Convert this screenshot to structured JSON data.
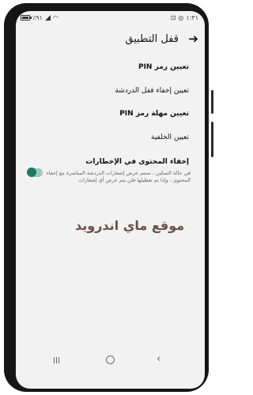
{
  "status_bar": {
    "battery_percent": "٪٩١",
    "time": "١:٣١",
    "icons": [
      "battery-icon",
      "signal-icon",
      "wifi-icon",
      "whatsapp-icon",
      "message-icon"
    ]
  },
  "header": {
    "title": "قفل التطبيق",
    "back_icon": "arrow-right-icon"
  },
  "settings": {
    "item1": "تعيين رمز PIN",
    "item2": "تعيين إخفاء قفل الدردشة",
    "item3": "تعيين مهلة رمز PIN",
    "item4": "تعيين الخلفية",
    "item5": "إخفاء المحتوى في الإخطارات",
    "item5_description": "في حالة التمكين ، ستتم عرض إشعارات الدردشة المباشرة مع إخفاء المحتوى ، وإذا تم تعطيلها فلن يتم عرض أي إشعارات",
    "toggle_state": "on"
  },
  "watermark": "موقع ماي اندرويد",
  "nav": {
    "recent_icon": "recent-apps-icon",
    "home_icon": "home-icon",
    "back_icon": "back-chevron-icon"
  }
}
